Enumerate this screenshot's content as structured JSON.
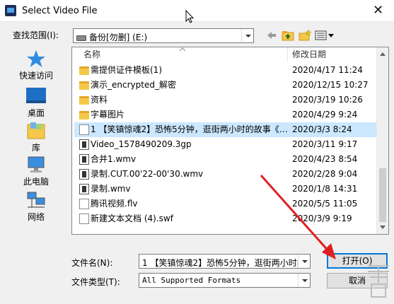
{
  "window": {
    "title": "Select Video File",
    "close_glyph": "✕"
  },
  "lookin": {
    "label": "查找范围(I):",
    "value": "备份[勿删] (E:)"
  },
  "toolbar": {
    "back_icon": "back-arrow-icon",
    "up_icon": "up-folder-icon",
    "new_folder_icon": "new-folder-icon",
    "view_icon": "view-menu-icon"
  },
  "places": [
    {
      "label": "快速访问",
      "icon": "star-icon"
    },
    {
      "label": "桌面",
      "icon": "desktop-icon"
    },
    {
      "label": "库",
      "icon": "library-icon"
    },
    {
      "label": "此电脑",
      "icon": "computer-icon"
    },
    {
      "label": "网络",
      "icon": "network-icon"
    }
  ],
  "columns": {
    "name": "名称",
    "date": "修改日期"
  },
  "files": [
    {
      "name": "需提供证件模板(1)",
      "date": "2020/4/17 11:24",
      "kind": "folder"
    },
    {
      "name": "演示_encrypted_解密",
      "date": "2020/12/15 10:27",
      "kind": "folder"
    },
    {
      "name": "资料",
      "date": "2020/3/19 10:26",
      "kind": "folder"
    },
    {
      "name": "字幕图片",
      "date": "2020/4/29 9:24",
      "kind": "folder"
    },
    {
      "name": "1 【笑镇惊魂2】恐怖5分钟，逛街两小时的故事《…",
      "date": "2020/3/3 8:24",
      "kind": "file",
      "selected": true
    },
    {
      "name": "Video_1578490209.3gp",
      "date": "2020/3/11 9:17",
      "kind": "media"
    },
    {
      "name": "合并1.wmv",
      "date": "2020/4/23 8:54",
      "kind": "media"
    },
    {
      "name": "录制.CUT.00'22-00'30.wmv",
      "date": "2020/2/28 9:04",
      "kind": "media"
    },
    {
      "name": "录制.wmv",
      "date": "2020/1/8 14:31",
      "kind": "media"
    },
    {
      "name": "腾讯视频.flv",
      "date": "2020/5/5 11:05",
      "kind": "file"
    },
    {
      "name": "新建文本文档 (4).swf",
      "date": "2020/3/9 9:19",
      "kind": "file"
    }
  ],
  "filename": {
    "label": "文件名(N):",
    "value": "1 【笑镇惊魂2】恐怖5分钟，逛街两小时的"
  },
  "filetype": {
    "label": "文件类型(T):",
    "value": "All Supported Formats"
  },
  "buttons": {
    "open": "打开(O)",
    "cancel": "取消"
  },
  "colors": {
    "selection": "#cce8ff",
    "folder": "#f5c84a",
    "arrow": "#e02020",
    "default_button_border": "#0078d7"
  }
}
